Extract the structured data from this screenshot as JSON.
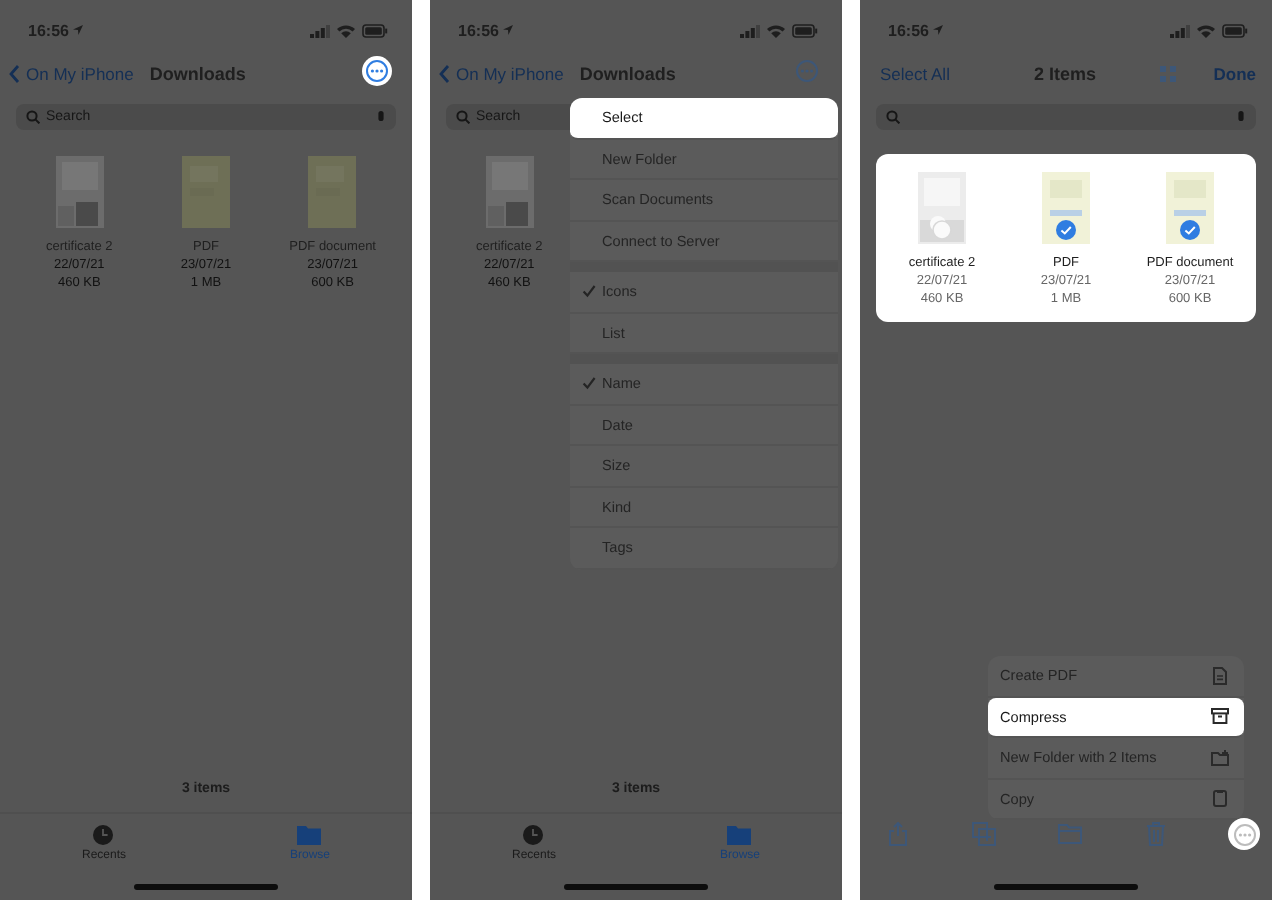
{
  "screens": [
    {
      "kind": "browse",
      "time": "16:56",
      "back": "On My iPhone",
      "title": "Downloads",
      "more_highlighted": true,
      "search": {
        "placeholder": "Search"
      },
      "files": [
        {
          "name": "certificate 2",
          "date": "22/07/21",
          "size": "460 KB",
          "kind": "certificate"
        },
        {
          "name": "PDF",
          "date": "23/07/21",
          "size": "1 MB",
          "kind": "pdf"
        },
        {
          "name": "PDF document",
          "date": "23/07/21",
          "size": "600 KB",
          "kind": "pdf"
        }
      ],
      "item_count": "3 items",
      "tabs": [
        {
          "label": "Recents",
          "selected": false
        },
        {
          "label": "Browse",
          "selected": true
        }
      ]
    },
    {
      "kind": "browse",
      "time": "16:56",
      "back": "On My iPhone",
      "title": "Downloads",
      "more_highlighted": false,
      "search": {
        "placeholder": "Search"
      },
      "files": [
        {
          "name": "certificate 2",
          "date": "22/07/21",
          "size": "460 KB",
          "kind": "certificate"
        }
      ],
      "item_count": "3 items",
      "tabs": [
        {
          "label": "Recents",
          "selected": false
        },
        {
          "label": "Browse",
          "selected": true
        }
      ],
      "menu": {
        "sections": [
          {
            "items": [
              {
                "label": "Select",
                "highlighted": true
              },
              {
                "label": "New Folder",
                "highlighted": false
              },
              {
                "label": "Scan Documents",
                "highlighted": false
              },
              {
                "label": "Connect to Server",
                "highlighted": false
              }
            ]
          },
          {
            "items": [
              {
                "label": "Icons",
                "highlighted": false,
                "checked": true
              },
              {
                "label": "List",
                "highlighted": false,
                "checked": false
              }
            ]
          },
          {
            "items": [
              {
                "label": "Name",
                "highlighted": false,
                "checked": true
              },
              {
                "label": "Date",
                "highlighted": false,
                "checked": false
              },
              {
                "label": "Size",
                "highlighted": false,
                "checked": false
              },
              {
                "label": "Kind",
                "highlighted": false,
                "checked": false
              },
              {
                "label": "Tags",
                "highlighted": false,
                "checked": false
              }
            ]
          }
        ]
      }
    },
    {
      "kind": "select",
      "time": "16:56",
      "select_all": "Select All",
      "title": "2 Items",
      "done": "Done",
      "more_highlighted": true,
      "files": [
        {
          "name": "certificate 2",
          "date": "22/07/21",
          "size": "460 KB",
          "kind": "certificate",
          "selected": false
        },
        {
          "name": "PDF",
          "date": "23/07/21",
          "size": "1 MB",
          "kind": "pdf",
          "selected": true
        },
        {
          "name": "PDF document",
          "date": "23/07/21",
          "size": "600 KB",
          "kind": "pdf",
          "selected": true
        }
      ],
      "menu": {
        "sections": [
          {
            "items": [
              {
                "label": "Create PDF",
                "highlighted": false
              },
              {
                "label": "Compress",
                "highlighted": true
              },
              {
                "label": "New Folder with 2 Items",
                "highlighted": false
              },
              {
                "label": "Copy",
                "highlighted": false
              }
            ]
          }
        ]
      }
    }
  ]
}
